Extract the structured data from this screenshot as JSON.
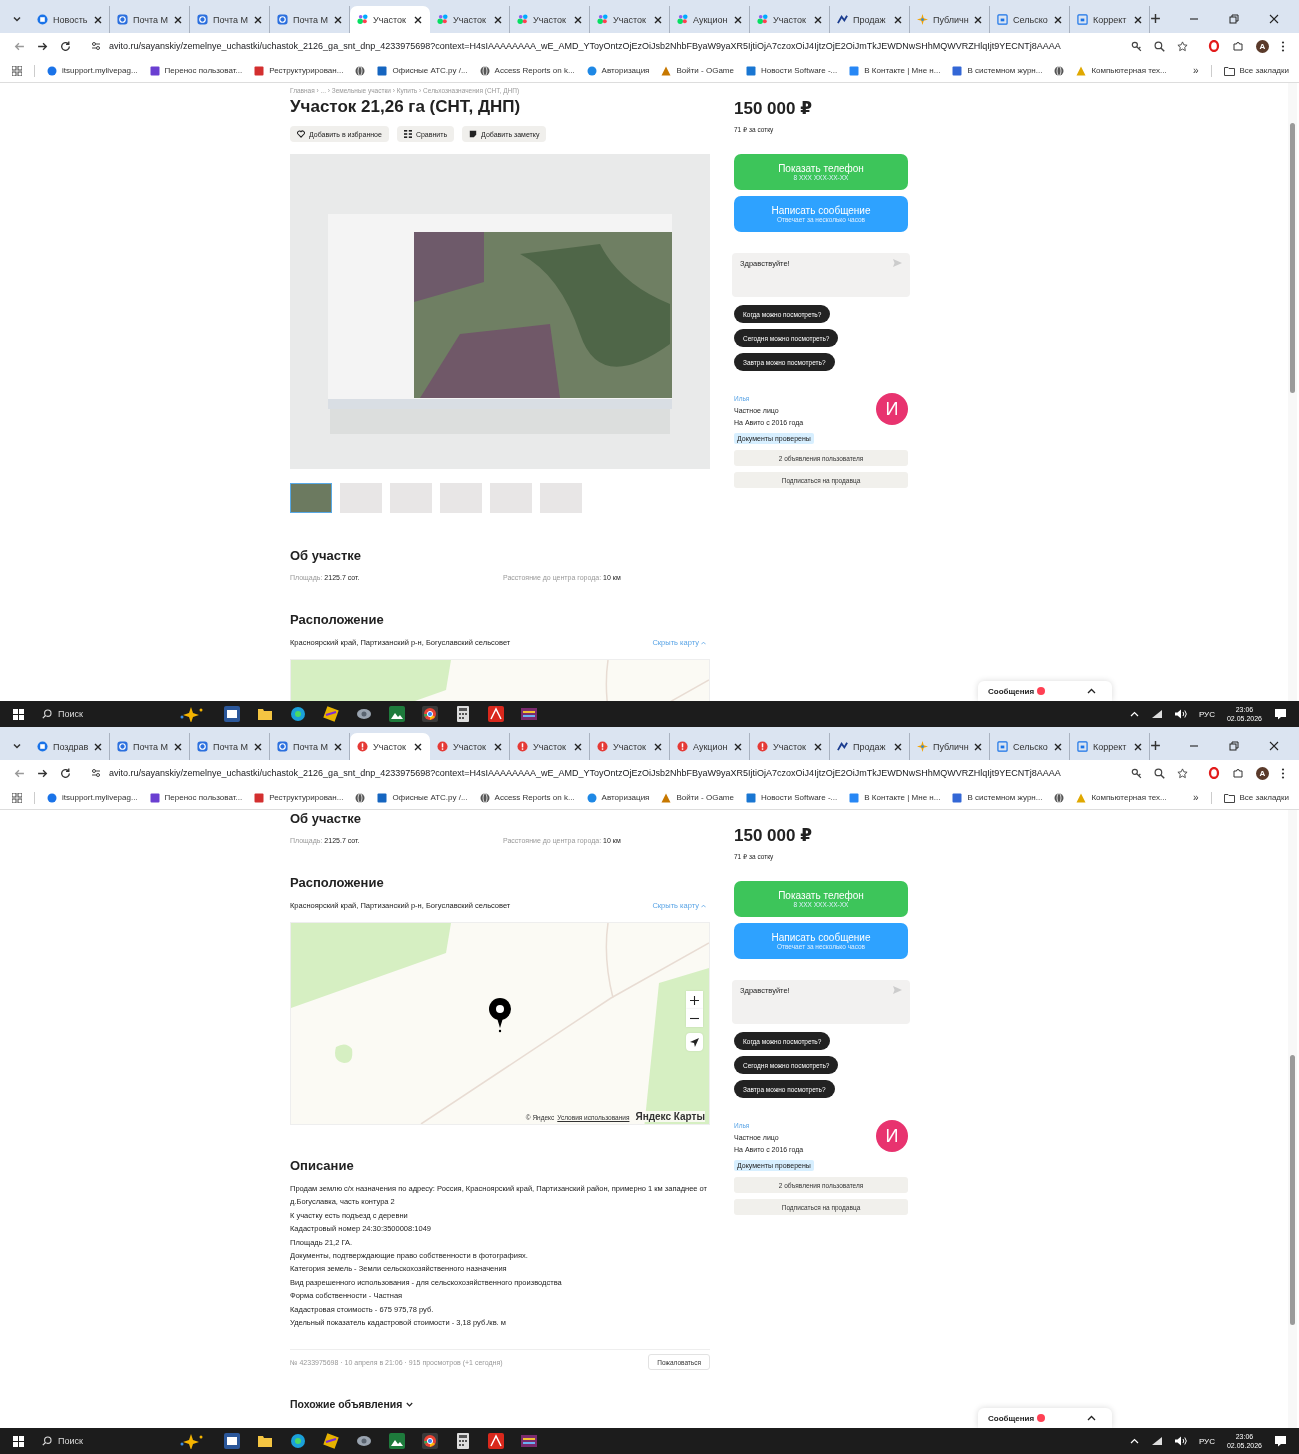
{
  "screens": [
    {
      "tabs": [
        {
          "label": "Новость",
          "kind": "news",
          "selected": false
        },
        {
          "label": "Почта М",
          "kind": "mail",
          "selected": false
        },
        {
          "label": "Почта М",
          "kind": "mail",
          "selected": false
        },
        {
          "label": "Почта М",
          "kind": "mail",
          "selected": false
        },
        {
          "label": "Участок",
          "kind": "avito",
          "selected": true
        },
        {
          "label": "Участок",
          "kind": "avito",
          "selected": false
        },
        {
          "label": "Участок",
          "kind": "avito",
          "selected": false
        },
        {
          "label": "Участок",
          "kind": "avito",
          "selected": false
        },
        {
          "label": "Аукцион",
          "kind": "avito",
          "selected": false
        },
        {
          "label": "Участок",
          "kind": "avito",
          "selected": false
        },
        {
          "label": "Продаж",
          "kind": "arrow",
          "selected": false
        },
        {
          "label": "Публичн",
          "kind": "star",
          "selected": false
        },
        {
          "label": "Сельско",
          "kind": "letter",
          "selected": false
        },
        {
          "label": "Коррект",
          "kind": "letter",
          "selected": false
        }
      ],
      "address": "avito.ru/sayanskiy/zemelnye_uchastki/uchastok_2126_ga_snt_dnp_4233975698?context=H4sIAAAAAAAA_wE_AMD_YToyOntzOjEzOiJsb2NhbFByaW9yaXR5IjtiOjA7czoxOiJ4IjtzOjE2OiJmTkJEWDNwSHhMQWVRZHlqIjt9YECNTj8AAAA",
      "profile_initial": "A",
      "bookmarks": [
        {
          "label": "itsupport.mylivepag...",
          "kind": "support"
        },
        {
          "label": "Перенос пользоват...",
          "kind": "letter"
        },
        {
          "label": "Реструктурирован...",
          "kind": "document"
        },
        {
          "kind": "globe"
        },
        {
          "label": "Офисные АТС.ру /...",
          "kind": "phone"
        },
        {
          "label": "Access Reports on k...",
          "kind": "globe"
        },
        {
          "label": "Авторизация",
          "kind": "auth"
        },
        {
          "label": "Войти - OGame",
          "kind": "game"
        },
        {
          "label": "Новости Software -...",
          "kind": "news"
        },
        {
          "label": "В Контакте | Мне н...",
          "kind": "social"
        },
        {
          "label": "В системном журн...",
          "kind": "journal"
        },
        {
          "kind": "globe"
        },
        {
          "label": "Компьютерная тех...",
          "kind": "tools"
        }
      ],
      "bookmarks_overflow": "»",
      "all_bookmarks": "Все закладки",
      "main": [
        {
          "kind": "breadcrumb",
          "text": "Главная › ... › Земельные участки › Купить › Сельхозназначения (СНТ, ДНП)"
        },
        {
          "kind": "title",
          "text": "Участок 21,26 га (СНТ, ДНП)"
        },
        {
          "kind": "actions",
          "buttons": [
            {
              "kind": "favorite",
              "label": "Добавить в избранное"
            },
            {
              "kind": "compare",
              "label": "Сравнить"
            },
            {
              "kind": "note",
              "label": "Добавить заметку"
            }
          ]
        },
        {
          "kind": "gallery",
          "thumbnails": [
            {
              "selected": true
            },
            {
              "selected": false
            },
            {
              "selected": false
            },
            {
              "selected": false
            },
            {
              "selected": false
            },
            {
              "selected": false
            }
          ]
        },
        {
          "kind": "about",
          "heading": "Об участке",
          "params": [
            {
              "label": "Площадь:",
              "value": "2125.7 сот."
            },
            {
              "label": "Расстояние до центра города:",
              "value": "10 км"
            }
          ]
        },
        {
          "kind": "location",
          "heading": "Расположение",
          "address": "Красноярский край, Партизанский р-н, Богуславский сельсовет",
          "toggle": "Скрыть карту"
        }
      ],
      "aside": {
        "price": "150 000 ₽",
        "price_per_unit": "71 ₽ за сотку",
        "phone_button": {
          "label": "Показать телефон",
          "sub": "8 XXX XXX-XX-XX"
        },
        "message_button": {
          "label": "Написать сообщение",
          "sub": "Отвечает за несколько часов"
        },
        "chat_value": "Здравствуйте!",
        "quick_replies": [
          "Когда можно посмотреть?",
          "Сегодня можно посмотреть?",
          "Завтра можно посмотреть?"
        ],
        "seller": {
          "name": "Илья",
          "type": "Частное лицо",
          "since": "На Авито с 2016 года",
          "avatar_letter": "И",
          "badge": "Документы проверены"
        },
        "seller_buttons": [
          "2 объявления пользователя",
          "Подписаться на продавца"
        ]
      },
      "messages_bar": {
        "label": "Сообщения"
      },
      "taskbar": {
        "search_placeholder": "Поиск",
        "language": "РУС",
        "time": "23:06",
        "date": "02.05.2026"
      }
    },
    {
      "tabs": [
        {
          "label": "Поздрав",
          "kind": "news",
          "selected": false
        },
        {
          "label": "Почта М",
          "kind": "mail",
          "selected": false
        },
        {
          "label": "Почта М",
          "kind": "mail",
          "selected": false
        },
        {
          "label": "Почта М",
          "kind": "mail",
          "selected": false
        },
        {
          "label": "Участок",
          "kind": "error",
          "selected": true
        },
        {
          "label": "Участок",
          "kind": "error",
          "selected": false
        },
        {
          "label": "Участок",
          "kind": "error",
          "selected": false
        },
        {
          "label": "Участок",
          "kind": "error",
          "selected": false
        },
        {
          "label": "Аукцион",
          "kind": "error",
          "selected": false
        },
        {
          "label": "Участок",
          "kind": "error",
          "selected": false
        },
        {
          "label": "Продаж",
          "kind": "arrow",
          "selected": false
        },
        {
          "label": "Публичн",
          "kind": "star",
          "selected": false
        },
        {
          "label": "Сельско",
          "kind": "letter",
          "selected": false
        },
        {
          "label": "Коррект",
          "kind": "letter",
          "selected": false
        }
      ],
      "address": "avito.ru/sayanskiy/zemelnye_uchastki/uchastok_2126_ga_snt_dnp_4233975698?context=H4sIAAAAAAAA_wE_AMD_YToyOntzOjEzOiJsb2NhbFByaW9yaXR5IjtiOjA7czoxOiJ4IjtzOjE2OiJmTkJEWDNwSHhMQWVRZHlqIjt9YECNTj8AAAA",
      "profile_initial": "A",
      "bookmarks": [
        {
          "label": "itsupport.mylivepag...",
          "kind": "support"
        },
        {
          "label": "Перенос пользоват...",
          "kind": "letter"
        },
        {
          "label": "Реструктурирован...",
          "kind": "document"
        },
        {
          "kind": "globe"
        },
        {
          "label": "Офисные АТС.ру /...",
          "kind": "phone"
        },
        {
          "label": "Access Reports on k...",
          "kind": "globe"
        },
        {
          "label": "Авторизация",
          "kind": "auth"
        },
        {
          "label": "Войти - OGame",
          "kind": "game"
        },
        {
          "label": "Новости Software -...",
          "kind": "news"
        },
        {
          "label": "В Контакте | Мне н...",
          "kind": "social"
        },
        {
          "label": "В системном журн...",
          "kind": "journal"
        },
        {
          "kind": "globe"
        },
        {
          "label": "Компьютерная тех...",
          "kind": "tools"
        }
      ],
      "bookmarks_overflow": "»",
      "all_bookmarks": "Все закладки",
      "main": [
        {
          "kind": "about",
          "heading": "Об участке",
          "params": [
            {
              "label": "Площадь:",
              "value": "2125.7 сот."
            },
            {
              "label": "Расстояние до центра города:",
              "value": "10 км"
            }
          ]
        },
        {
          "kind": "location",
          "heading": "Расположение",
          "address": "Красноярский край, Партизанский р-н, Богуславский сельсовет",
          "toggle": "Скрыть карту",
          "attribution": "© Яндекс",
          "terms": "Условия использования",
          "map_logo": "Яндекс Карты"
        },
        {
          "kind": "description",
          "heading": "Описание",
          "lines": [
            "Продам землю с/х назначения по адресу: Россия, Красноярский край, Партизанский район, примерно 1 км западнее от д.Богуславка, часть контура 2",
            "К участку есть подъезд с деревни",
            "Кадастровый номер 24:30:3500008:1049",
            "Площадь 21,2 ГА.",
            "Документы, подтверждающие право собственности в фотографиях.",
            "Категория земель - Земли сельскохозяйственного назначения",
            "Вид разрешенного использования - для сельскохозяйственного производства",
            "Форма собственности - Частная",
            "Кадастровая стоимость - 675 975,78 руб.",
            "Удельный показатель кадастровой стоимости - 3,18 руб./кв. м"
          ]
        },
        {
          "kind": "footer",
          "meta": "№ 4233975698 · 10 апреля в 21:06 · 915 просмотров (+1 сегодня)",
          "report": "Пожаловаться"
        },
        {
          "kind": "similar",
          "heading": "Похожие объявления"
        }
      ],
      "aside": {
        "price": "150 000 ₽",
        "price_per_unit": "71 ₽ за сотку",
        "phone_button": {
          "label": "Показать телефон",
          "sub": "8 XXX XXX-XX-XX"
        },
        "message_button": {
          "label": "Написать сообщение",
          "sub": "Отвечает за несколько часов"
        },
        "chat_value": "Здравствуйте!",
        "quick_replies": [
          "Когда можно посмотреть?",
          "Сегодня можно посмотреть?",
          "Завтра можно посмотреть?"
        ],
        "seller": {
          "name": "Илья",
          "type": "Частное лицо",
          "since": "На Авито с 2016 года",
          "avatar_letter": "И",
          "badge": "Документы проверены"
        },
        "seller_buttons": [
          "2 объявления пользователя",
          "Подписаться на продавца"
        ]
      },
      "messages_bar": {
        "label": "Сообщения"
      },
      "taskbar": {
        "search_placeholder": "Поиск",
        "language": "РУС",
        "time": "23:06",
        "date": "02.05.2026"
      }
    }
  ]
}
